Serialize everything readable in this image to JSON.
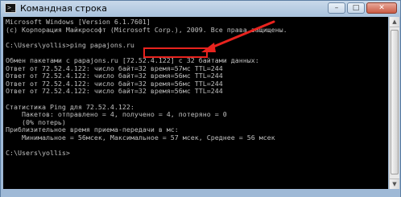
{
  "window": {
    "title": "Командная строка",
    "icons": {
      "app": "cmd-icon",
      "minimize": "minimize-icon",
      "maximize": "maximize-icon",
      "close": "close-icon"
    },
    "caption": {
      "minimize": "–",
      "maximize": "□",
      "close": "✕"
    }
  },
  "console": {
    "lines": [
      "Microsoft Windows [Version 6.1.7601]",
      "(c) Корпорация Майкрософт (Microsoft Corp.), 2009. Все права защищены.",
      "",
      "C:\\Users\\yollis>ping papajons.ru",
      "",
      "Обмен пакетами с papajons.ru [72.52.4.122] с 32 байтами данных:",
      "Ответ от 72.52.4.122: число байт=32 время=57мс TTL=244",
      "Ответ от 72.52.4.122: число байт=32 время=56мс TTL=244",
      "Ответ от 72.52.4.122: число байт=32 время=56мс TTL=244",
      "Ответ от 72.52.4.122: число байт=32 время=56мс TTL=244",
      "",
      "Статистика Ping для 72.52.4.122:",
      "    Пакетов: отправлено = 4, получено = 4, потеряно = 0",
      "    (0% потерь)",
      "Приблизительное время приема-передачи в мс:",
      "    Минимальное = 56мсек, Максимальное = 57 мсек, Среднее = 56 мсек",
      "",
      "C:\\Users\\yollis>"
    ],
    "text_color": "#c0c0c0",
    "background_color": "#000000",
    "annotation_color": "#e8231e"
  },
  "scrollbar": {
    "up_glyph": "▲",
    "down_glyph": "▼"
  }
}
